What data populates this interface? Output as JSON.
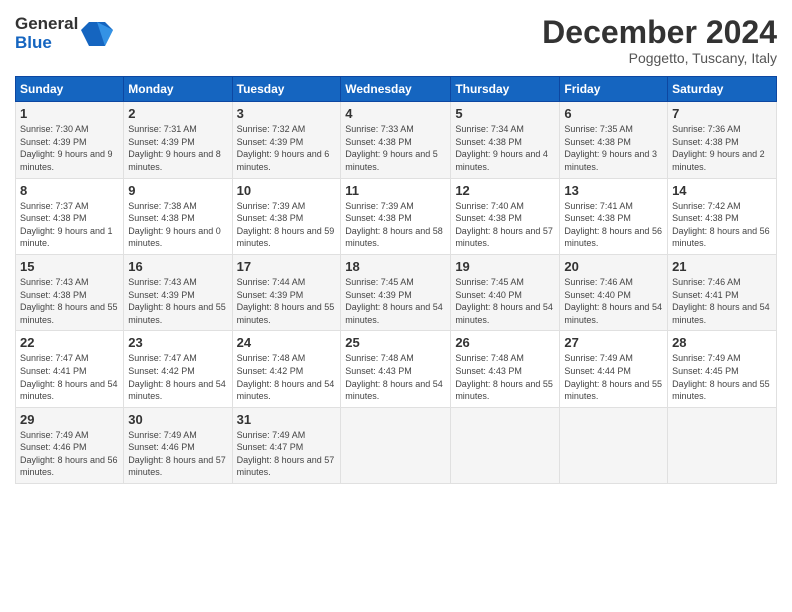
{
  "header": {
    "logo_line1": "General",
    "logo_line2": "Blue",
    "month": "December 2024",
    "location": "Poggetto, Tuscany, Italy"
  },
  "weekdays": [
    "Sunday",
    "Monday",
    "Tuesday",
    "Wednesday",
    "Thursday",
    "Friday",
    "Saturday"
  ],
  "weeks": [
    [
      {
        "day": "1",
        "sunrise": "7:30 AM",
        "sunset": "4:39 PM",
        "daylight": "9 hours and 9 minutes."
      },
      {
        "day": "2",
        "sunrise": "7:31 AM",
        "sunset": "4:39 PM",
        "daylight": "9 hours and 8 minutes."
      },
      {
        "day": "3",
        "sunrise": "7:32 AM",
        "sunset": "4:39 PM",
        "daylight": "9 hours and 6 minutes."
      },
      {
        "day": "4",
        "sunrise": "7:33 AM",
        "sunset": "4:38 PM",
        "daylight": "9 hours and 5 minutes."
      },
      {
        "day": "5",
        "sunrise": "7:34 AM",
        "sunset": "4:38 PM",
        "daylight": "9 hours and 4 minutes."
      },
      {
        "day": "6",
        "sunrise": "7:35 AM",
        "sunset": "4:38 PM",
        "daylight": "9 hours and 3 minutes."
      },
      {
        "day": "7",
        "sunrise": "7:36 AM",
        "sunset": "4:38 PM",
        "daylight": "9 hours and 2 minutes."
      }
    ],
    [
      {
        "day": "8",
        "sunrise": "7:37 AM",
        "sunset": "4:38 PM",
        "daylight": "9 hours and 1 minute."
      },
      {
        "day": "9",
        "sunrise": "7:38 AM",
        "sunset": "4:38 PM",
        "daylight": "9 hours and 0 minutes."
      },
      {
        "day": "10",
        "sunrise": "7:39 AM",
        "sunset": "4:38 PM",
        "daylight": "8 hours and 59 minutes."
      },
      {
        "day": "11",
        "sunrise": "7:39 AM",
        "sunset": "4:38 PM",
        "daylight": "8 hours and 58 minutes."
      },
      {
        "day": "12",
        "sunrise": "7:40 AM",
        "sunset": "4:38 PM",
        "daylight": "8 hours and 57 minutes."
      },
      {
        "day": "13",
        "sunrise": "7:41 AM",
        "sunset": "4:38 PM",
        "daylight": "8 hours and 56 minutes."
      },
      {
        "day": "14",
        "sunrise": "7:42 AM",
        "sunset": "4:38 PM",
        "daylight": "8 hours and 56 minutes."
      }
    ],
    [
      {
        "day": "15",
        "sunrise": "7:43 AM",
        "sunset": "4:38 PM",
        "daylight": "8 hours and 55 minutes."
      },
      {
        "day": "16",
        "sunrise": "7:43 AM",
        "sunset": "4:39 PM",
        "daylight": "8 hours and 55 minutes."
      },
      {
        "day": "17",
        "sunrise": "7:44 AM",
        "sunset": "4:39 PM",
        "daylight": "8 hours and 55 minutes."
      },
      {
        "day": "18",
        "sunrise": "7:45 AM",
        "sunset": "4:39 PM",
        "daylight": "8 hours and 54 minutes."
      },
      {
        "day": "19",
        "sunrise": "7:45 AM",
        "sunset": "4:40 PM",
        "daylight": "8 hours and 54 minutes."
      },
      {
        "day": "20",
        "sunrise": "7:46 AM",
        "sunset": "4:40 PM",
        "daylight": "8 hours and 54 minutes."
      },
      {
        "day": "21",
        "sunrise": "7:46 AM",
        "sunset": "4:41 PM",
        "daylight": "8 hours and 54 minutes."
      }
    ],
    [
      {
        "day": "22",
        "sunrise": "7:47 AM",
        "sunset": "4:41 PM",
        "daylight": "8 hours and 54 minutes."
      },
      {
        "day": "23",
        "sunrise": "7:47 AM",
        "sunset": "4:42 PM",
        "daylight": "8 hours and 54 minutes."
      },
      {
        "day": "24",
        "sunrise": "7:48 AM",
        "sunset": "4:42 PM",
        "daylight": "8 hours and 54 minutes."
      },
      {
        "day": "25",
        "sunrise": "7:48 AM",
        "sunset": "4:43 PM",
        "daylight": "8 hours and 54 minutes."
      },
      {
        "day": "26",
        "sunrise": "7:48 AM",
        "sunset": "4:43 PM",
        "daylight": "8 hours and 55 minutes."
      },
      {
        "day": "27",
        "sunrise": "7:49 AM",
        "sunset": "4:44 PM",
        "daylight": "8 hours and 55 minutes."
      },
      {
        "day": "28",
        "sunrise": "7:49 AM",
        "sunset": "4:45 PM",
        "daylight": "8 hours and 55 minutes."
      }
    ],
    [
      {
        "day": "29",
        "sunrise": "7:49 AM",
        "sunset": "4:46 PM",
        "daylight": "8 hours and 56 minutes."
      },
      {
        "day": "30",
        "sunrise": "7:49 AM",
        "sunset": "4:46 PM",
        "daylight": "8 hours and 57 minutes."
      },
      {
        "day": "31",
        "sunrise": "7:49 AM",
        "sunset": "4:47 PM",
        "daylight": "8 hours and 57 minutes."
      },
      null,
      null,
      null,
      null
    ]
  ]
}
